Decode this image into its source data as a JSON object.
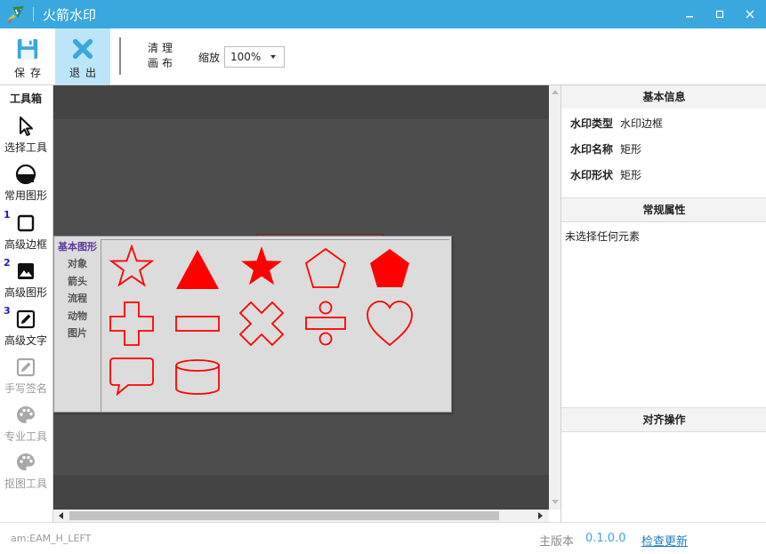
{
  "window": {
    "title": "火箭水印",
    "controls": [
      "minimize",
      "maximize",
      "close"
    ]
  },
  "toolbar": {
    "save_label": "保存",
    "exit_label": "退出",
    "clear_line1": "清理",
    "clear_line2": "画布",
    "zoom_label": "缩放",
    "zoom_value": "100%"
  },
  "toolbox": {
    "title": "工具箱",
    "tools": [
      {
        "label": "选择工具",
        "icon": "cursor-icon",
        "enabled": true,
        "number": ""
      },
      {
        "label": "常用图形",
        "icon": "shape-icon",
        "enabled": true,
        "number": ""
      },
      {
        "label": "高级边框",
        "icon": "border-icon",
        "enabled": true,
        "number": "1"
      },
      {
        "label": "高级图形",
        "icon": "image-icon",
        "enabled": true,
        "number": "2"
      },
      {
        "label": "高级文字",
        "icon": "edit-icon",
        "enabled": true,
        "number": "3"
      },
      {
        "label": "手写签名",
        "icon": "signature-icon",
        "enabled": false,
        "number": ""
      },
      {
        "label": "专业工具",
        "icon": "palette-icon",
        "enabled": false,
        "number": ""
      },
      {
        "label": "抠图工具",
        "icon": "palette-icon",
        "enabled": false,
        "number": ""
      }
    ]
  },
  "shape_panel": {
    "categories": [
      "基本图形",
      "对象",
      "箭头",
      "流程",
      "动物",
      "图片"
    ],
    "active_category": "基本图形",
    "shapes": [
      "star-outline",
      "triangle-filled",
      "star-filled",
      "pentagon-outline",
      "pentagon-filled",
      "cross-outline",
      "minus-outline",
      "x-outline",
      "divide-outline",
      "heart-outline",
      "speech-bubble-outline",
      "cylinder-outline"
    ],
    "shape_color": "#ff0000"
  },
  "properties": {
    "basic_info_title": "基本信息",
    "fields": [
      {
        "label": "水印类型",
        "value": "水印边框"
      },
      {
        "label": "水印名称",
        "value": "矩形"
      },
      {
        "label": "水印形状",
        "value": "矩形"
      }
    ],
    "general_title": "常规属性",
    "no_selection": "未选择任何元素",
    "align_title": "对齐操作"
  },
  "status": {
    "left_text": "am:EAM_H_LEFT",
    "version_label": "主版本",
    "version": "0.1.0.0",
    "update_link": "检查更新"
  },
  "colors": {
    "accent": "#3aa7df",
    "exit_highlight": "#bde5f8",
    "canvas": "#4d4d4d"
  }
}
